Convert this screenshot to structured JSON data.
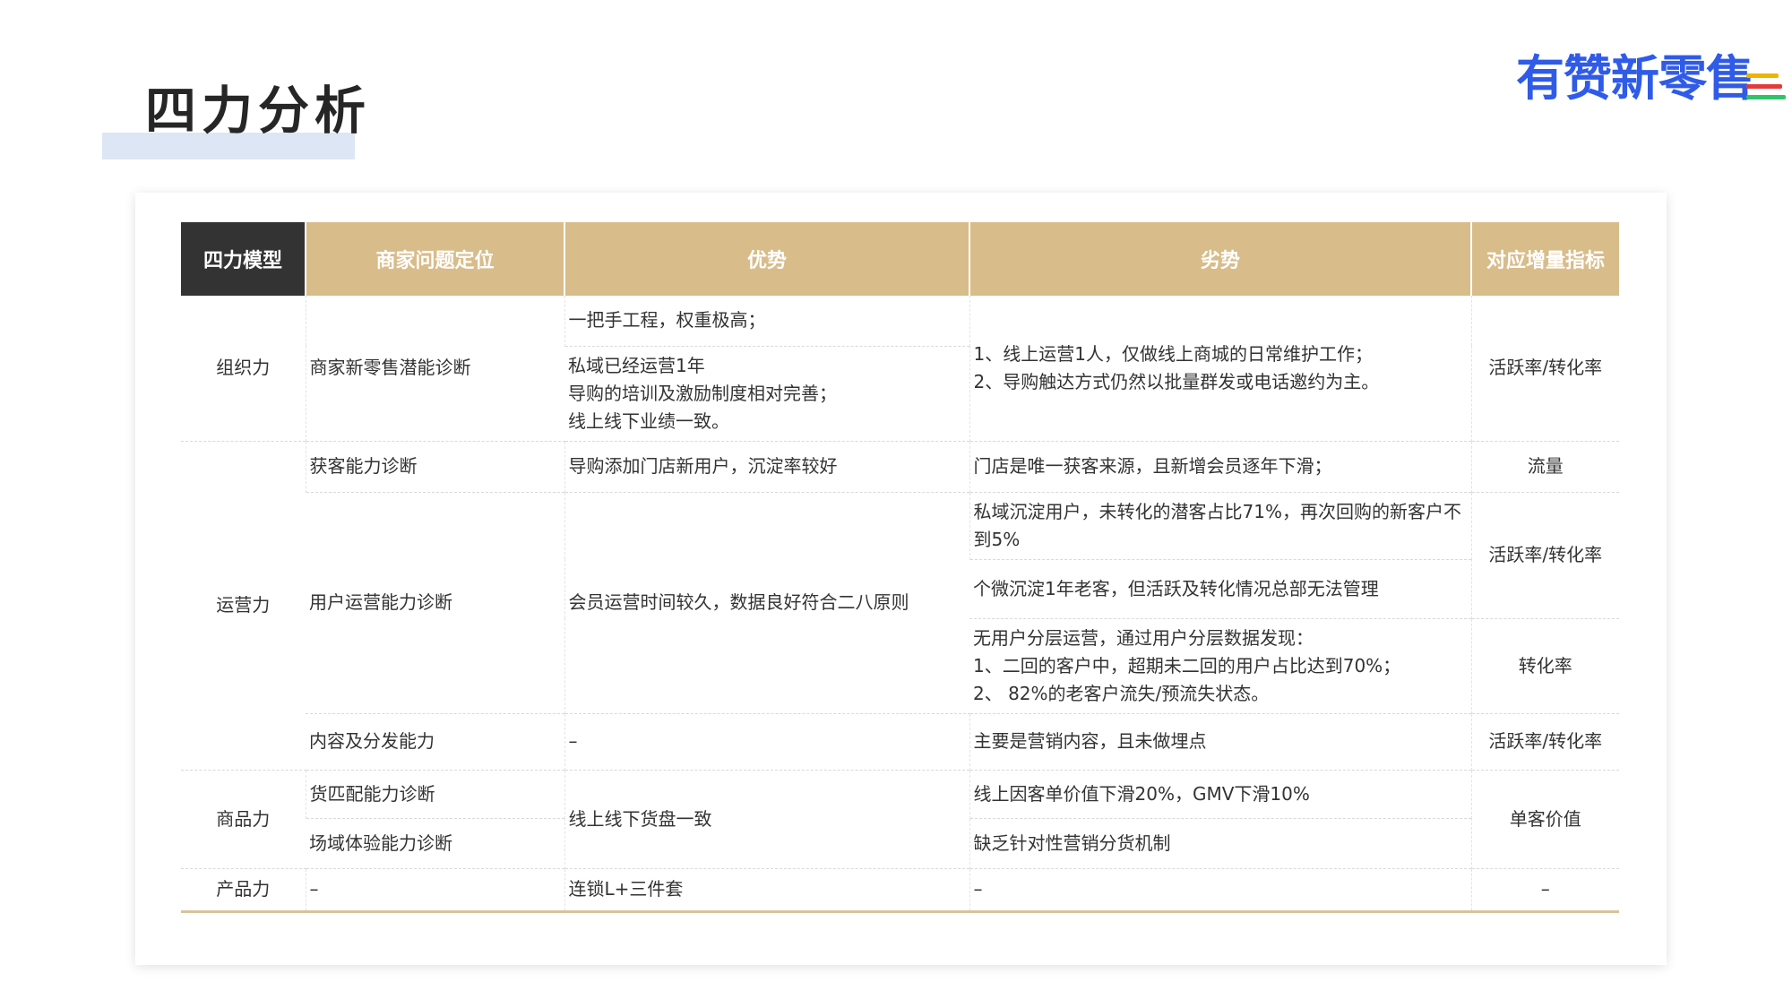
{
  "page": {
    "title": "四力分析",
    "logo": "有赞新零售"
  },
  "table": {
    "headers": [
      "四力模型",
      "商家问题定位",
      "优势",
      "劣势",
      "对应增量指标"
    ],
    "org": {
      "category": "组织力",
      "problem": "商家新零售潜能诊断",
      "adv1": "一把手工程，权重极高；",
      "adv2": [
        "私域已经运营1年",
        "导购的培训及激励制度相对完善；",
        "线上线下业绩一致。"
      ],
      "dis": [
        "1、线上运营1人，仅做线上商城的日常维护工作；",
        "2、导购触达方式仍然以批量群发或电话邀约为主。"
      ],
      "metric": "活跃率/转化率"
    },
    "ops": {
      "category": "运营力",
      "acq_problem": "获客能力诊断",
      "acq_adv": "导购添加门店新用户，沉淀率较好",
      "acq_dis": "门店是唯一获客来源，且新增会员逐年下滑；",
      "acq_metric": "流量",
      "user_problem": "用户运营能力诊断",
      "user_adv": "会员运营时间较久，数据良好符合二八原则",
      "user_dis1": "私域沉淀用户，未转化的潜客占比71%，再次回购的新客户不到5%",
      "user_dis2": "个微沉淀1年老客，但活跃及转化情况总部无法管理",
      "user_metric1": "活跃率/转化率",
      "user_dis3": [
        "无用户分层运营，通过用户分层数据发现：",
        "1、二回的客户中，超期未二回的用户占比达到70%；",
        "2、 82%的老客户流失/预流失状态。"
      ],
      "user_metric2": "转化率",
      "content_problem": "内容及分发能力",
      "content_adv": "–",
      "content_dis": "主要是营销内容，且未做埋点",
      "content_metric": "活跃率/转化率"
    },
    "goods": {
      "category": "商品力",
      "problem1": "货匹配能力诊断",
      "problem2": "场域体验能力诊断",
      "adv": "线上线下货盘一致",
      "dis1": "线上因客单价值下滑20%，GMV下滑10%",
      "dis2": "缺乏针对性营销分货机制",
      "metric": "单客价值"
    },
    "product": {
      "category": "产品力",
      "problem": "–",
      "adv": "连锁L+三件套",
      "dis": "–",
      "metric": "–"
    }
  }
}
